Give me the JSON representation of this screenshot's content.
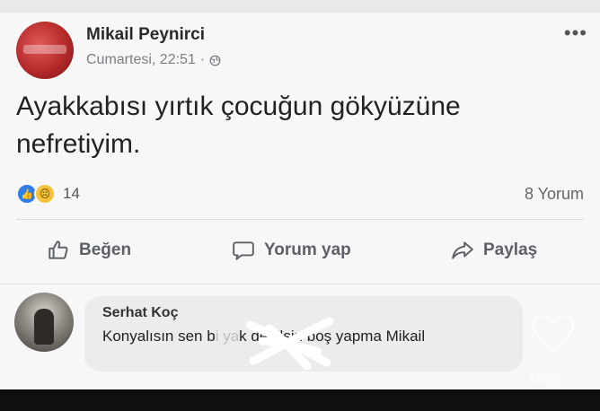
{
  "post": {
    "author": "Mikail Peynirci",
    "timestamp": "Cumartesi, 22:51",
    "separator": "·",
    "more_icon": "more-options-icon",
    "text": "Ayakkabısı yırtık çocuğun gökyüzüne nefretiyim.",
    "reaction_count": "14",
    "comment_count": "8 Yorum",
    "actions": {
      "like": "Beğen",
      "comment": "Yorum yap",
      "share": "Paylaş"
    }
  },
  "comment": {
    "author": "Serhat Koç",
    "text_before": "Konyalısın sen b",
    "text_hidden": "i ya",
    "text_after": "k değilsin boş yapma Mikail"
  },
  "overlay": {
    "like_label": "Beğe"
  },
  "colors": {
    "accent_blue": "#2f7ee6",
    "sad_yellow": "#f3c43b",
    "meta_gray": "#7b7e83"
  }
}
